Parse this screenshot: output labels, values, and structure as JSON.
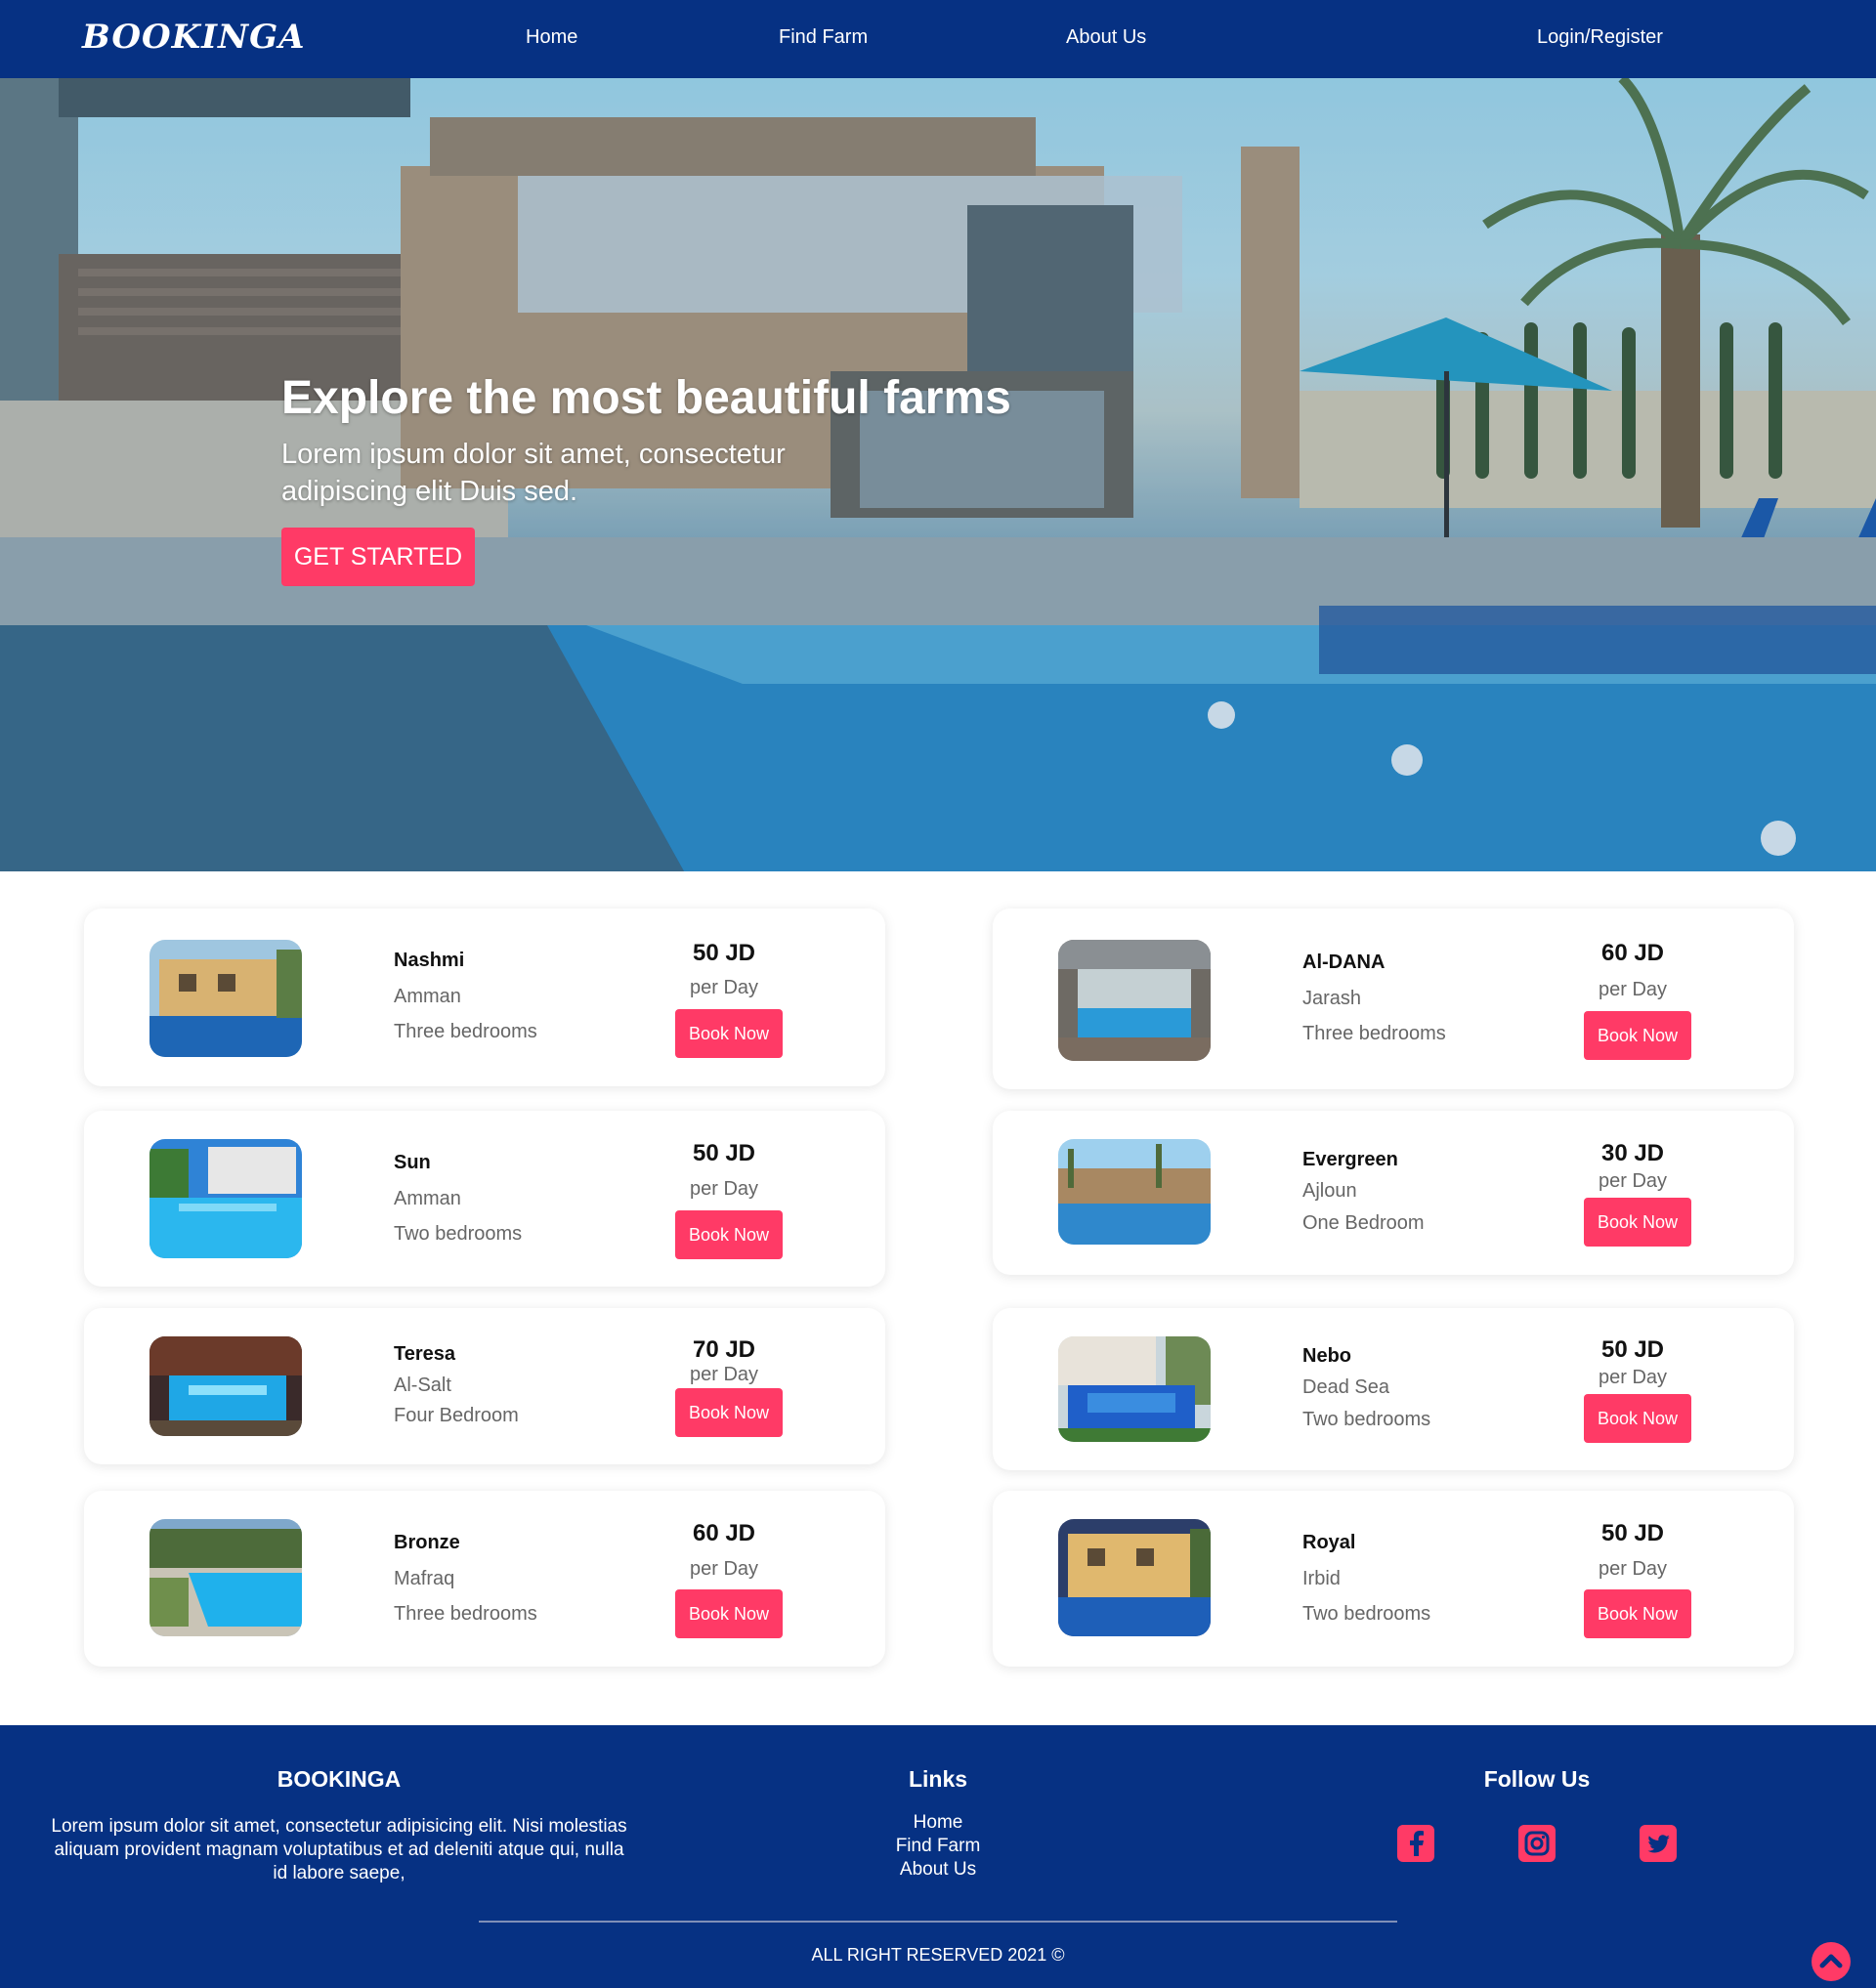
{
  "nav": {
    "logo": "BOOKINGA",
    "links": [
      "Home",
      "Find Farm",
      "About Us"
    ],
    "login": "Login/Register"
  },
  "hero": {
    "title": "Explore the most beautiful farms",
    "subtitle": "Lorem ipsum dolor sit amet, consectetur adipiscing elit Duis sed.",
    "cta": "GET STARTED"
  },
  "listings": [
    {
      "name": "Nashmi",
      "city": "Amman",
      "rooms": "Three bedrooms",
      "price": "50 JD",
      "per": "per Day",
      "button": "Book Now"
    },
    {
      "name": "Al-DANA",
      "city": "Jarash",
      "rooms": "Three bedrooms",
      "price": "60 JD",
      "per": "per Day",
      "button": "Book Now"
    },
    {
      "name": "Sun",
      "city": "Amman",
      "rooms": "Two bedrooms",
      "price": "50 JD",
      "per": "per Day",
      "button": "Book Now"
    },
    {
      "name": "Evergreen",
      "city": "Ajloun",
      "rooms": "One Bedroom",
      "price": "30 JD",
      "per": "per Day",
      "button": "Book Now"
    },
    {
      "name": "Teresa",
      "city": "Al-Salt",
      "rooms": "Four Bedroom",
      "price": "70 JD",
      "per": "per Day",
      "button": "Book Now"
    },
    {
      "name": "Nebo",
      "city": "Dead Sea",
      "rooms": "Two bedrooms",
      "price": "50 JD",
      "per": "per Day",
      "button": "Book Now"
    },
    {
      "name": "Bronze",
      "city": "Mafraq",
      "rooms": "Three bedrooms",
      "price": "60 JD",
      "per": "per Day",
      "button": "Book Now"
    },
    {
      "name": "Royal",
      "city": "Irbid",
      "rooms": "Two bedrooms",
      "price": "50 JD",
      "per": "per Day",
      "button": "Book Now"
    }
  ],
  "footer": {
    "brand": "BOOKINGA",
    "description": "Lorem ipsum dolor sit amet, consectetur adipisicing elit. Nisi molestias aliquam provident magnam voluptatibus et ad deleniti atque qui, nulla id labore saepe,",
    "links_heading": "Links",
    "links": [
      "Home",
      "Find Farm",
      "About Us"
    ],
    "follow_heading": "Follow Us",
    "social_icons": [
      "facebook-icon",
      "instagram-icon",
      "twitter-icon"
    ],
    "copyright": "ALL RIGHT RESERVED 2021 ©"
  },
  "colors": {
    "nav_bg": "#063183",
    "accent": "#ff3a66",
    "footer_bg": "#063183"
  }
}
